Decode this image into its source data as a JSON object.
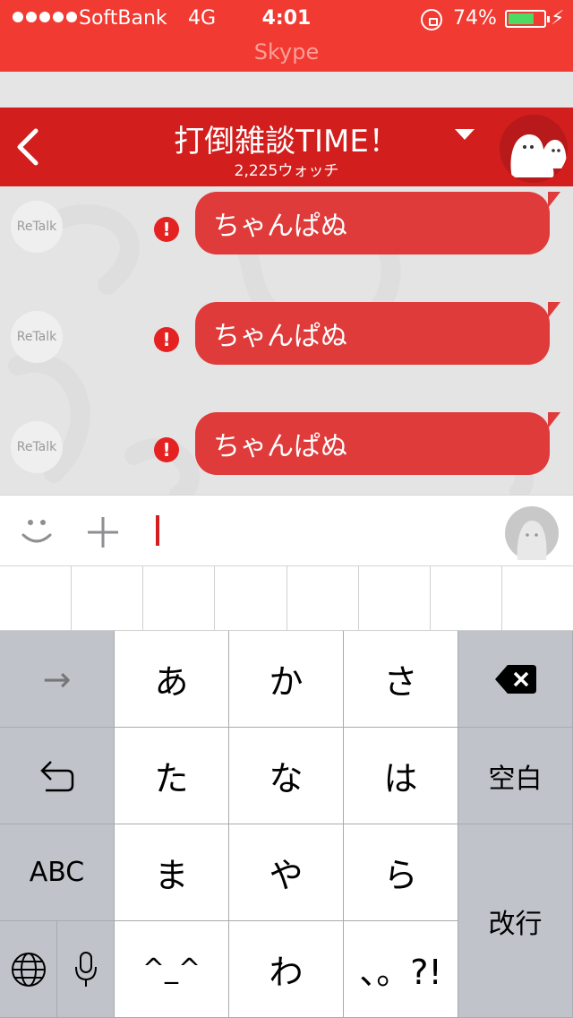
{
  "status_bar": {
    "carrier": "SoftBank",
    "network": "4G",
    "time": "4:01",
    "battery": "74%",
    "battery_level": 0.74,
    "icons": [
      "signal-dots-icon",
      "rotation-lock-icon",
      "battery-icon",
      "charging-bolt-icon"
    ]
  },
  "app": {
    "title": "Skype"
  },
  "header": {
    "title": "打倒雑談TIME！",
    "watchers": "2,225ウォッチ"
  },
  "messages": [
    {
      "avatar": "ReTalk",
      "text": "ちゃんぱぬ",
      "status": "error-icon"
    },
    {
      "avatar": "ReTalk",
      "text": "ちゃんぱぬ",
      "status": "error-icon"
    },
    {
      "avatar": "ReTalk",
      "text": "ちゃんぱぬ",
      "status": "error-icon"
    }
  ],
  "input": {
    "value": ""
  },
  "keyboard": {
    "arrow": "→",
    "a": "あ",
    "ka": "か",
    "sa": "さ",
    "ta": "た",
    "na": "な",
    "ha": "は",
    "space": "空白",
    "abc": "ABC",
    "ma": "ま",
    "ya": "や",
    "ra": "ら",
    "return": "改行",
    "kaomoji": "^_^",
    "wa": "わ",
    "punct": "、。?!"
  },
  "colors": {
    "status_red": "#f03a32",
    "header_red": "#d21e1d",
    "bubble_red": "#df3b3a",
    "error_red": "#e52222",
    "battery_green": "#4cd964"
  }
}
